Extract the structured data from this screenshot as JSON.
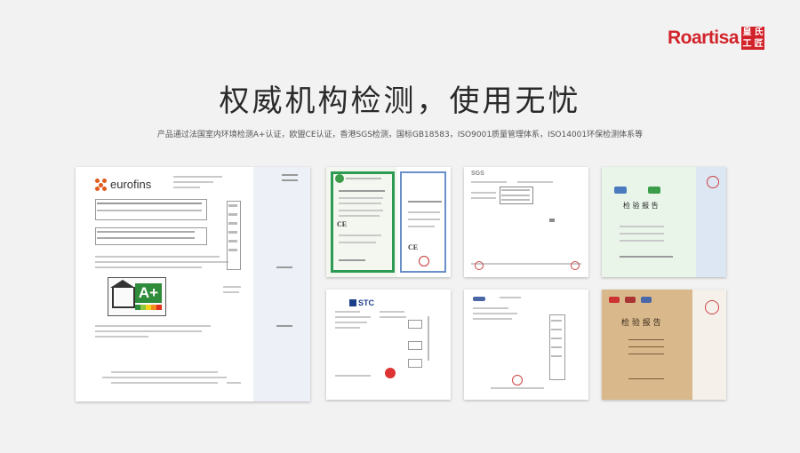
{
  "brand": {
    "wordmark": "Roartisa",
    "seal_chars": [
      "皇",
      "氏",
      "工",
      "匠"
    ],
    "color": "#d2232a"
  },
  "headline": "权威机构检测，使用无忧",
  "subline": "产品通过法国室内环境检测A+认证，欧盟CE认证，香港SGS检测，国标GB18583，ISO9001质量管理体系，ISO14001环保检测体系等",
  "certificates": {
    "eurofins": {
      "logo": "eurofins",
      "grade": "A+",
      "scale_colors": [
        "#2e8b3a",
        "#8dc63f",
        "#f3d11b",
        "#f08c1d",
        "#e0301e"
      ]
    },
    "ce": {
      "mark": "CE"
    },
    "sgs": {
      "mark": "SGS"
    },
    "greenlab": {
      "title": "检 验 报 告"
    },
    "stc": {
      "mark": "STC"
    },
    "kraft": {
      "title": "检 验 报 告"
    }
  }
}
